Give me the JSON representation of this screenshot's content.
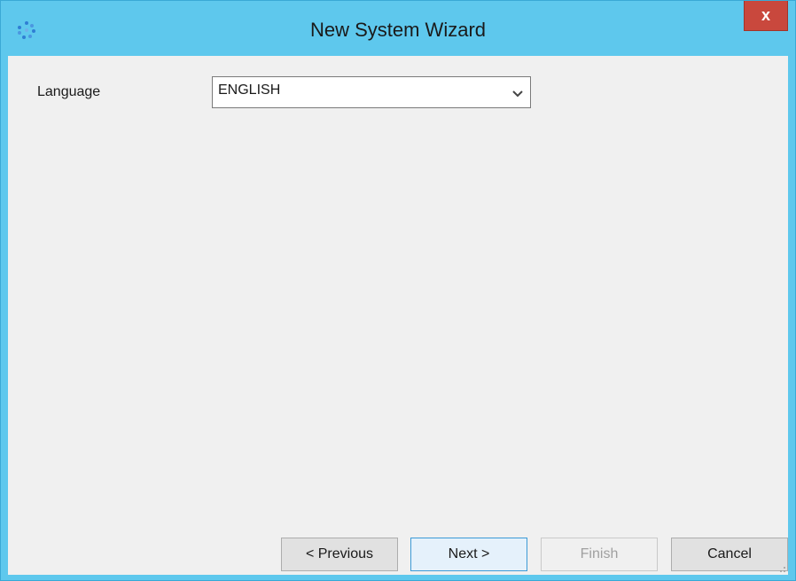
{
  "window": {
    "title": "New System Wizard",
    "close_label": "x",
    "app_icon": "app-gear-icon",
    "accent_color": "#5ec8ed",
    "close_color": "#c9483d"
  },
  "form": {
    "language_label": "Language",
    "language_value": "ENGLISH",
    "dropdown_icon": "chevron-down-icon"
  },
  "buttons": {
    "previous_label": "< Previous",
    "next_label": "Next >",
    "finish_label": "Finish",
    "cancel_label": "Cancel"
  }
}
